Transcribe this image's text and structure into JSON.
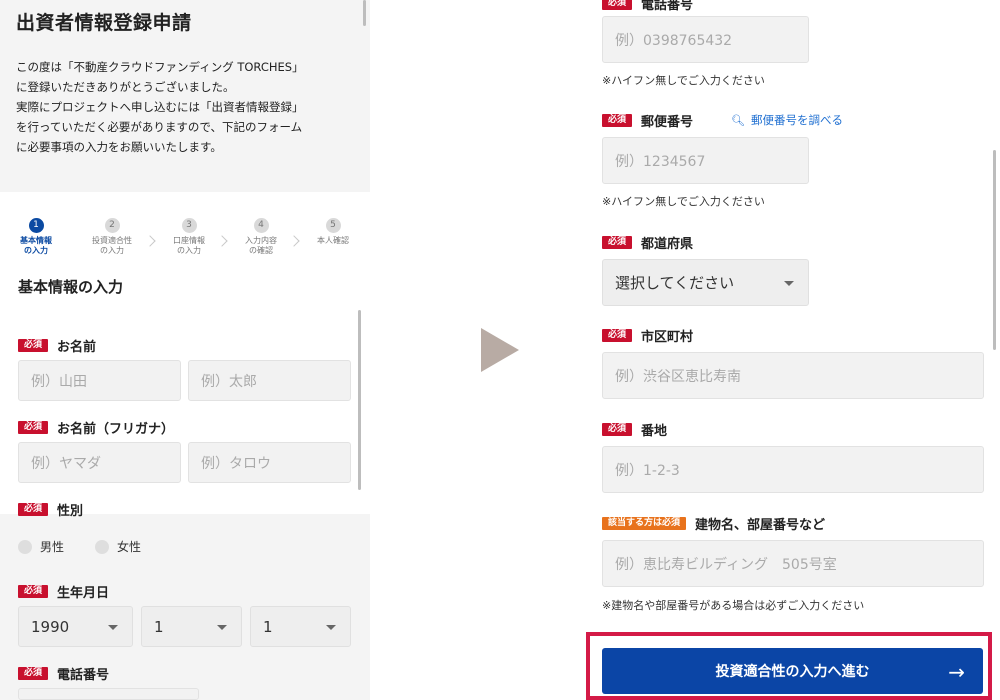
{
  "intro": {
    "title": "出資者情報登録申請",
    "lines": [
      "この度は「不動産クラウドファンディング TORCHES」",
      "に登録いただきありがとうございました。",
      "実際にプロジェクトへ申し込むには「出資者情報登録」",
      "を行っていただく必要がありますので、下記のフォーム",
      "に必要事項の入力をお願いいたします。"
    ]
  },
  "steps": [
    {
      "num": "1",
      "line1": "基本情報",
      "line2": "の入力",
      "active": true
    },
    {
      "num": "2",
      "line1": "投資適合性",
      "line2": "の入力",
      "active": false
    },
    {
      "num": "3",
      "line1": "口座情報",
      "line2": "の入力",
      "active": false
    },
    {
      "num": "4",
      "line1": "入力内容",
      "line2": "の確認",
      "active": false
    },
    {
      "num": "5",
      "line1": "本人確認",
      "line2": "",
      "active": false
    }
  ],
  "section_title": "基本情報の入力",
  "required_badge": "必須",
  "conditional_badge": "該当する方は必須",
  "left_form": {
    "name_label": "お名前",
    "name_last_placeholder": "例）山田",
    "name_first_placeholder": "例）太郎",
    "kana_label": "お名前（フリガナ）",
    "kana_last_placeholder": "例）ヤマダ",
    "kana_first_placeholder": "例）タロウ",
    "gender_label": "性別",
    "gender_male": "男性",
    "gender_female": "女性",
    "birth_label": "生年月日",
    "birth_year": "1990",
    "birth_month": "1",
    "birth_day": "1",
    "phone_label": "電話番号"
  },
  "right_form": {
    "phone_label_partial": "電話番号",
    "phone_placeholder": "例）0398765432",
    "phone_note": "※ハイフン無しでご入力ください",
    "zip_label": "郵便番号",
    "zip_link": "郵便番号を調べる",
    "zip_placeholder": "例）1234567",
    "zip_note": "※ハイフン無しでご入力ください",
    "pref_label": "都道府県",
    "pref_value": "選択してください",
    "city_label": "市区町村",
    "city_placeholder": "例）渋谷区恵比寿南",
    "street_label": "番地",
    "street_placeholder": "例）1-2-3",
    "building_label": "建物名、部屋番号など",
    "building_placeholder": "例）恵比寿ビルディング　505号室",
    "building_note": "※建物名や部屋番号がある場合は必ずご入力ください",
    "submit_label": "投資適合性の入力へ進む",
    "submit_arrow": "→"
  },
  "colors": {
    "primary": "#0b45a6",
    "required": "#c8102e",
    "conditional": "#e8721c",
    "highlight_frame": "#d41a47",
    "link": "#1f6fd1"
  }
}
